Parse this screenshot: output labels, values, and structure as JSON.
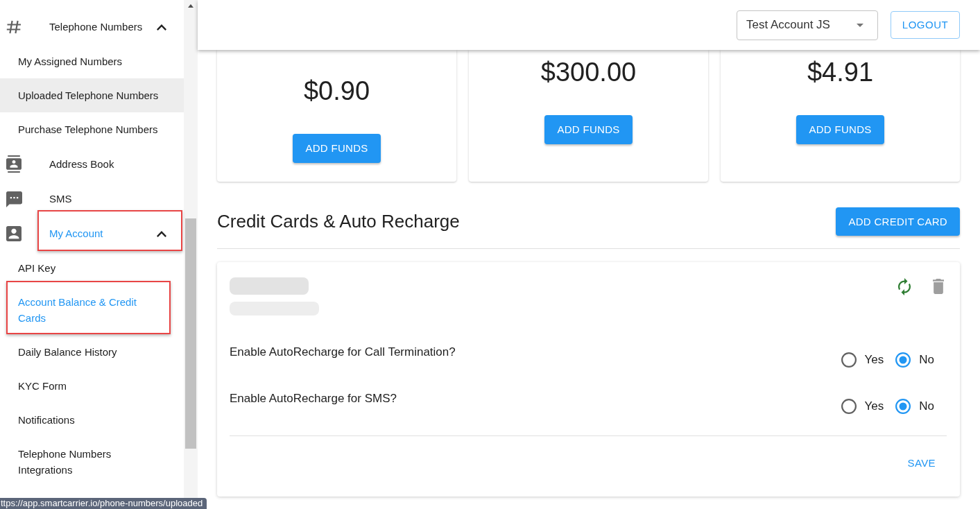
{
  "sidebar": {
    "items": [
      {
        "kind": "group",
        "label": "Telephone Numbers",
        "expanded": true,
        "selected": false,
        "highlighted": false,
        "children": [
          {
            "label": "My Assigned Numbers",
            "selected": false,
            "hovered": false,
            "highlighted": false
          },
          {
            "label": "Uploaded Telephone Numbers",
            "selected": false,
            "hovered": true,
            "highlighted": false
          },
          {
            "label": "Purchase Telephone Numbers",
            "selected": false,
            "hovered": false,
            "highlighted": false
          }
        ]
      },
      {
        "kind": "link",
        "label": "Address Book",
        "selected": false,
        "highlighted": false
      },
      {
        "kind": "link",
        "label": "SMS",
        "selected": false,
        "highlighted": false
      },
      {
        "kind": "group",
        "label": "My Account",
        "expanded": true,
        "selected": true,
        "highlighted": true,
        "children": [
          {
            "label": "API Key",
            "selected": false,
            "hovered": false,
            "highlighted": false
          },
          {
            "label": "Account Balance & Credit Cards",
            "selected": true,
            "hovered": false,
            "highlighted": true
          },
          {
            "label": "Daily Balance History",
            "selected": false,
            "hovered": false,
            "highlighted": false
          },
          {
            "label": "KYC Form",
            "selected": false,
            "hovered": false,
            "highlighted": false
          },
          {
            "label": "Notifications",
            "selected": false,
            "hovered": false,
            "highlighted": false
          },
          {
            "label": "Telephone Numbers Integrations",
            "selected": false,
            "hovered": false,
            "highlighted": false
          }
        ]
      }
    ]
  },
  "header": {
    "account_select": {
      "value": "Test Account JS"
    },
    "logout_button": "LOGOUT"
  },
  "balances": [
    {
      "amount": "$0.90",
      "button": "ADD FUNDS"
    },
    {
      "amount": "$300.00",
      "button": "ADD FUNDS"
    },
    {
      "amount": "$4.91",
      "button": "ADD FUNDS"
    }
  ],
  "credit_cards": {
    "title": "Credit Cards & Auto Recharge",
    "add_button": "ADD CREDIT CARD",
    "cards": [
      {
        "questions": [
          {
            "label": "Enable AutoRecharge for Call Termination?",
            "options": [
              {
                "label": "Yes",
                "selected": false
              },
              {
                "label": "No",
                "selected": true
              }
            ]
          },
          {
            "label": "Enable AutoRecharge for SMS?",
            "options": [
              {
                "label": "Yes",
                "selected": false
              },
              {
                "label": "No",
                "selected": true
              }
            ]
          }
        ],
        "save_button": "SAVE"
      }
    ]
  },
  "status_bar": {
    "url": "ttps://app.smartcarrier.io/phone-numbers/uploaded"
  }
}
